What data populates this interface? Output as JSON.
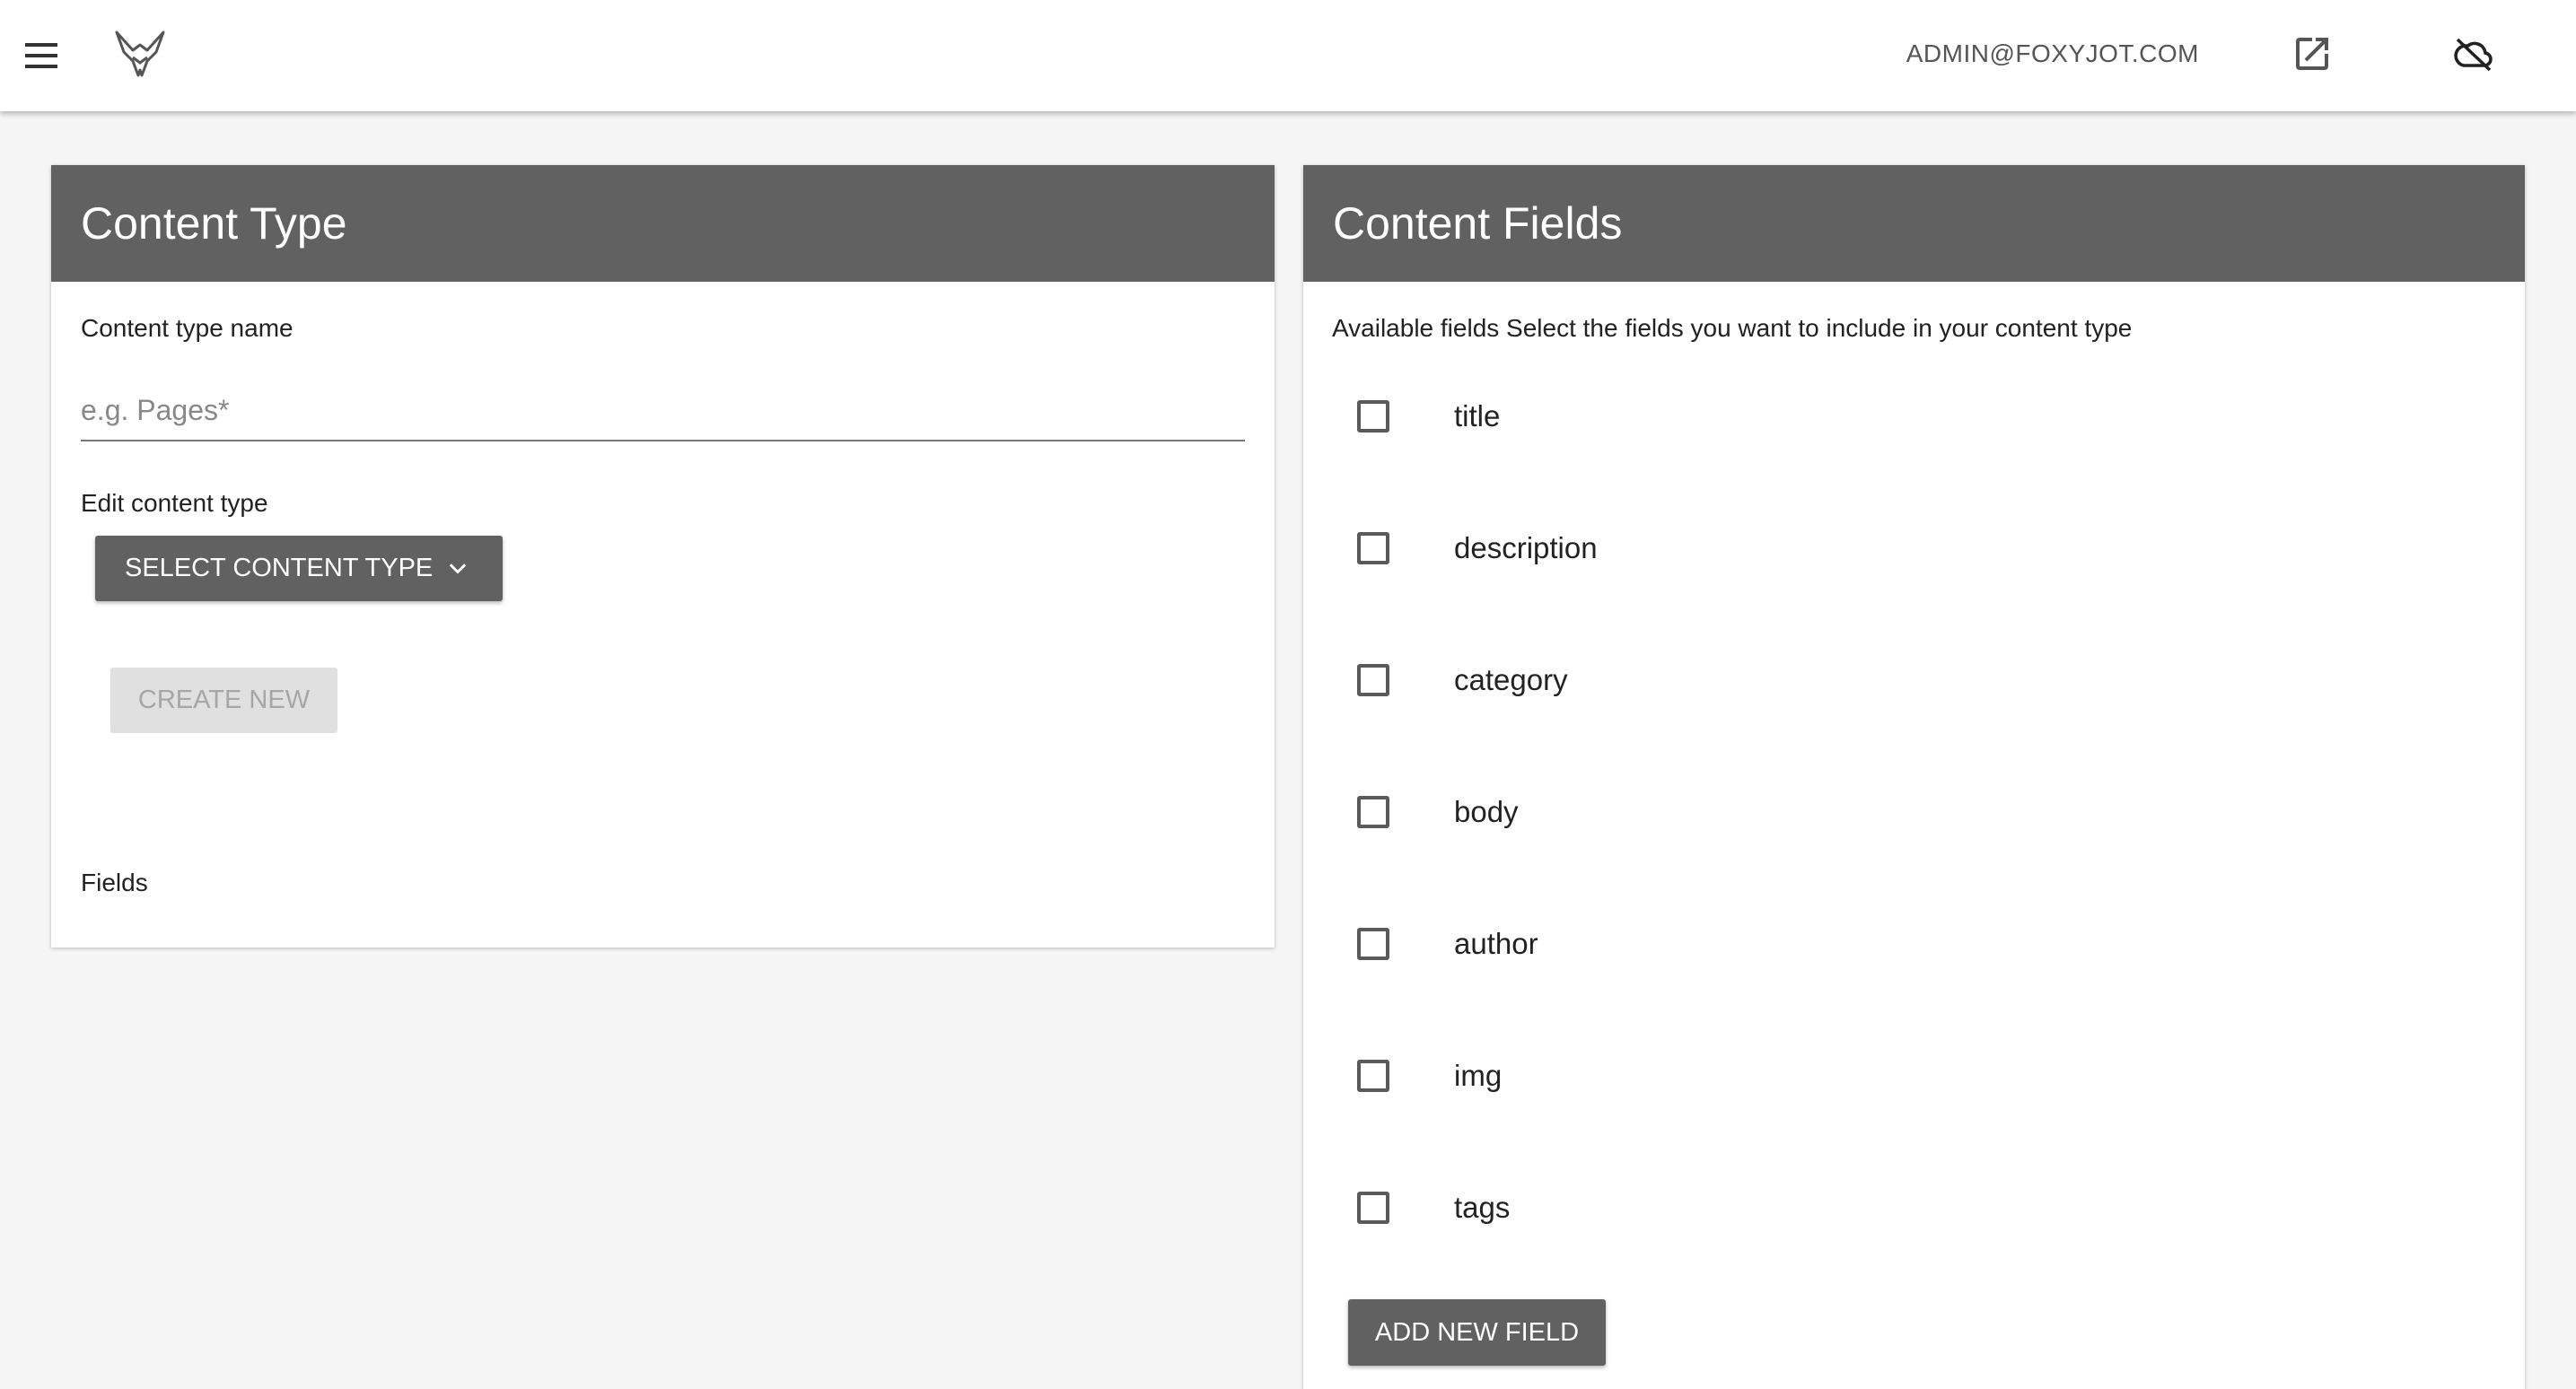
{
  "topbar": {
    "user_email": "ADMIN@FOXYJOT.COM",
    "menu_icon": "hamburger-menu-icon",
    "logo_icon": "fox-logo-icon",
    "open_external_icon": "open-in-new-icon",
    "cloud_icon": "cloud-off-icon"
  },
  "content_type_card": {
    "title": "Content Type",
    "name_label": "Content type name",
    "name_placeholder": "e.g. Pages*",
    "name_value": "",
    "edit_label": "Edit content type",
    "select_button_label": "SELECT CONTENT TYPE",
    "create_button_label": "CREATE NEW",
    "fields_label": "Fields"
  },
  "content_fields_card": {
    "title": "Content Fields",
    "description": "Available fields Select the fields you want to include in your content type",
    "fields": [
      {
        "name": "title",
        "checked": false
      },
      {
        "name": "description",
        "checked": false
      },
      {
        "name": "category",
        "checked": false
      },
      {
        "name": "body",
        "checked": false
      },
      {
        "name": "author",
        "checked": false
      },
      {
        "name": "img",
        "checked": false
      },
      {
        "name": "tags",
        "checked": false
      }
    ],
    "add_button_label": "ADD NEW FIELD"
  },
  "colors": {
    "header_bg": "#616161",
    "page_bg": "#f5f5f5",
    "disabled_bg": "#e0e0e0",
    "disabled_text": "#a6a6a6"
  }
}
